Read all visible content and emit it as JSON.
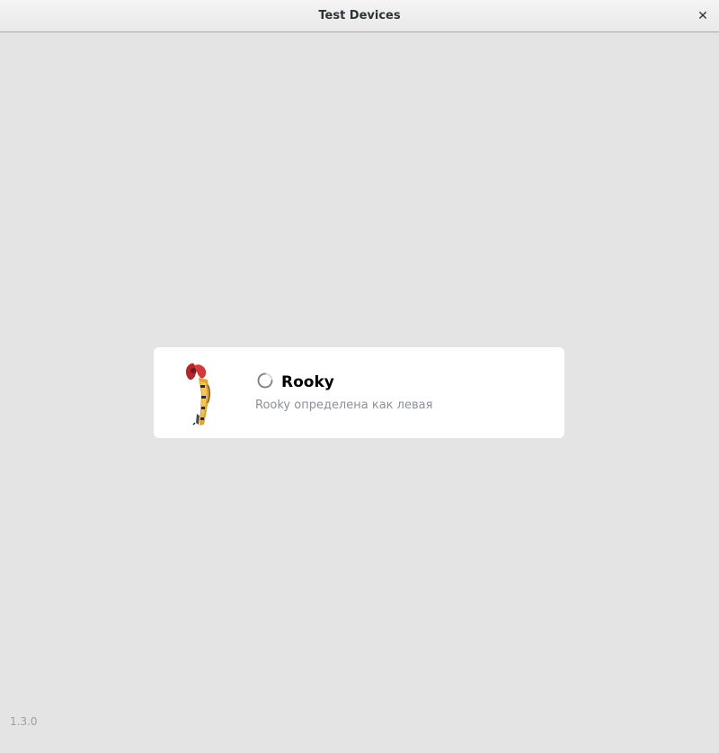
{
  "window": {
    "title": "Test Devices",
    "close_icon": "close-icon"
  },
  "device": {
    "name": "Rooky",
    "status": "Rooky определена как левая",
    "image_icon": "robot-hand-icon",
    "loading_icon": "spinner-icon"
  },
  "footer": {
    "version": "1.3.0"
  },
  "colors": {
    "background": "#e4e4e4",
    "card": "#ffffff",
    "status_text": "#8a8f99",
    "version_text": "#9a9ea5"
  }
}
